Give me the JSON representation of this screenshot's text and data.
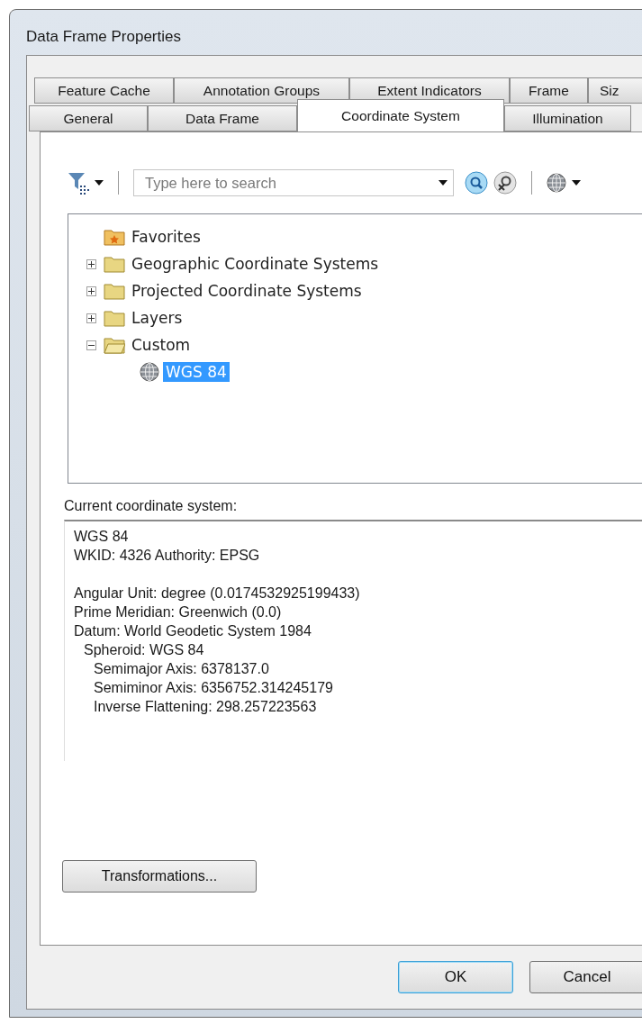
{
  "window": {
    "title": "Data Frame Properties"
  },
  "tab_rows": [
    [
      {
        "label": "Feature Cache",
        "selected": false
      },
      {
        "label": "Annotation Groups",
        "selected": false
      },
      {
        "label": "Extent Indicators",
        "selected": false
      },
      {
        "label": "Frame",
        "selected": false
      },
      {
        "label": "Siz",
        "selected": false
      }
    ],
    [
      {
        "label": "General",
        "selected": false
      },
      {
        "label": "Data Frame",
        "selected": false
      },
      {
        "label": "Coordinate System",
        "selected": true
      },
      {
        "label": "Illumination",
        "selected": false
      }
    ]
  ],
  "search": {
    "placeholder": "Type here to search"
  },
  "tree": [
    {
      "label": "Favorites",
      "kind": "favorites",
      "selected": false
    },
    {
      "label": "Geographic Coordinate Systems",
      "kind": "folder",
      "expanded": false,
      "selected": false
    },
    {
      "label": "Projected Coordinate Systems",
      "kind": "folder",
      "expanded": false,
      "selected": false
    },
    {
      "label": "Layers",
      "kind": "folder",
      "expanded": false,
      "selected": false
    },
    {
      "label": "Custom",
      "kind": "folder",
      "expanded": true,
      "selected": false,
      "children": [
        {
          "label": "WGS 84",
          "kind": "crs",
          "selected": true
        }
      ]
    }
  ],
  "current_label": "Current coordinate system:",
  "current_details": {
    "header_lines": [
      "WGS 84",
      "WKID: 4326 Authority: EPSG"
    ],
    "parameters": [
      {
        "text": "Angular Unit: degree (0.0174532925199433)"
      },
      {
        "text": "Prime Meridian: Greenwich (0.0)"
      },
      {
        "text": "Datum: World Geodetic System 1984",
        "children": [
          {
            "text": "Spheroid: WGS 84",
            "children": [
              {
                "text": "Semimajor Axis: 6378137.0"
              },
              {
                "text": "Semiminor Axis: 6356752.314245179"
              },
              {
                "text": "Inverse Flattening: 298.257223563"
              }
            ]
          }
        ]
      }
    ]
  },
  "transformations_button": "Transformations...",
  "buttons": [
    {
      "label": "OK",
      "default": true
    },
    {
      "label": "Cancel",
      "default": false
    }
  ]
}
